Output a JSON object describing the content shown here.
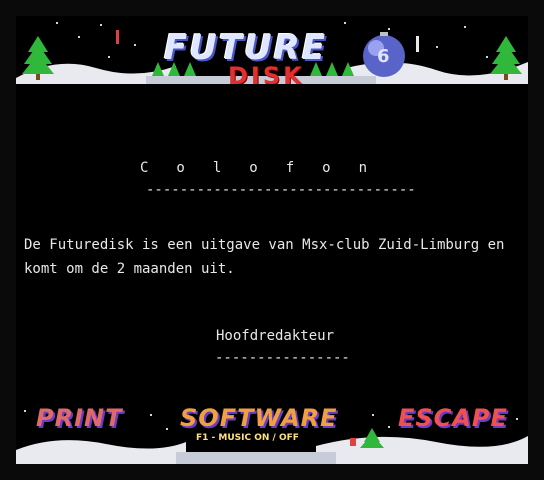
{
  "header": {
    "logo_top": "FUTURE",
    "logo_bottom": "DISK",
    "issue_badge": "6"
  },
  "content": {
    "title": "Colofon",
    "title_rule": "--------------------------------",
    "body": "De Futuredisk is een uitgave van Msx-club Zuid-Limburg en\nkomt om de 2 maanden uit.",
    "subhead": "Hoofdredakteur",
    "subhead_rule": "----------------"
  },
  "footer": {
    "print_label": "PRINT",
    "software_label": "SOFTWARE",
    "escape_label": "ESCAPE",
    "music_hint": "F1 - MUSIC ON / OFF"
  },
  "colors": {
    "background": "#000000",
    "text": "#e8e8e8",
    "snow": "#e8eaf0",
    "tree": "#2fb83a",
    "ornament": "#5a64c8"
  },
  "icons": [
    "christmas-tree-icon",
    "ornament-ball-icon",
    "snowflake-icon",
    "candle-icon"
  ]
}
